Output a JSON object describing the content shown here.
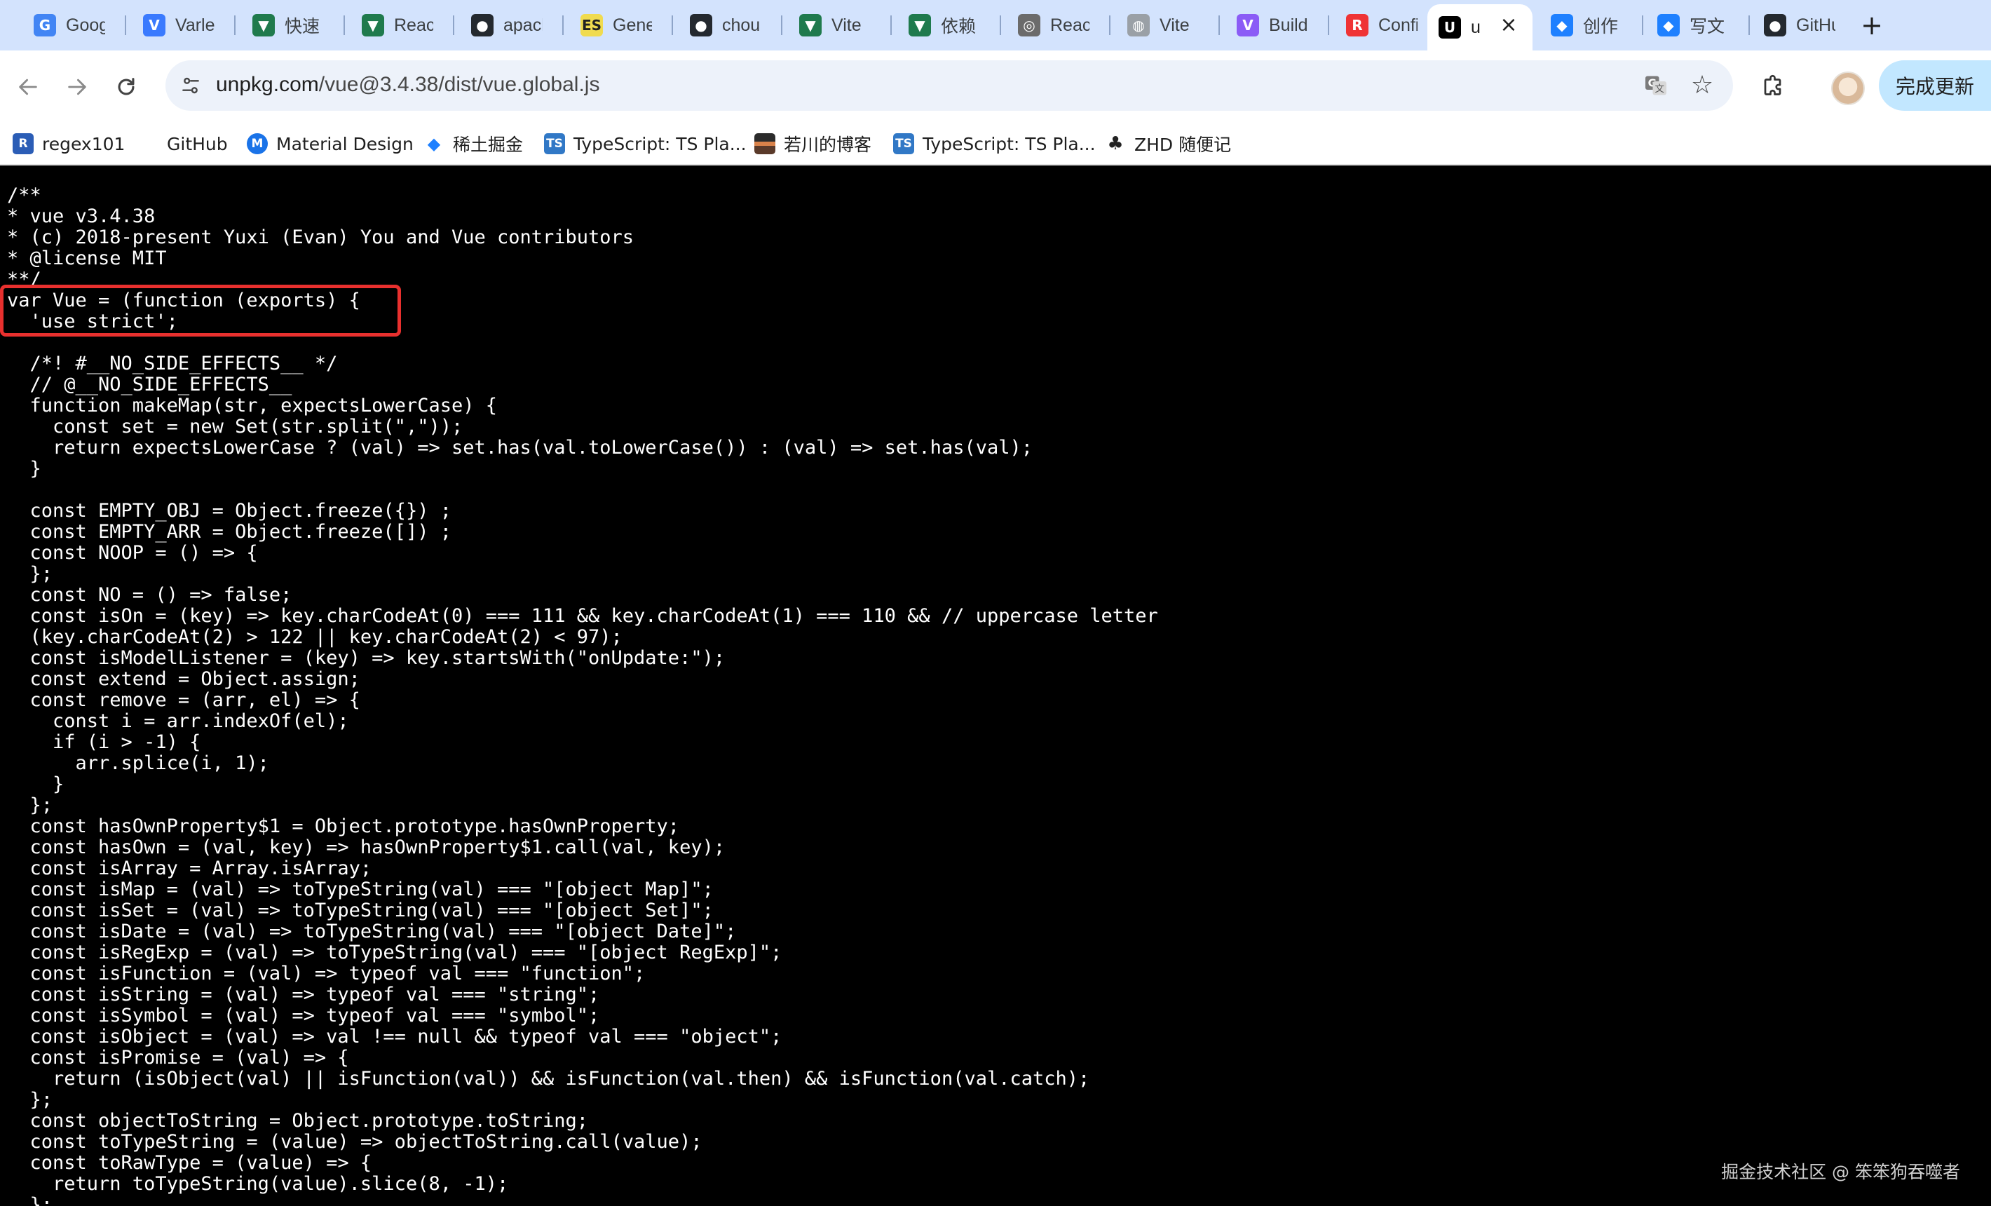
{
  "tabs": [
    {
      "label": "Goog",
      "icon": "google-translate-icon",
      "color": "#4285f4",
      "glyph": "G"
    },
    {
      "label": "Varle",
      "icon": "varlet-icon",
      "color": "#3a7afe",
      "glyph": "V"
    },
    {
      "label": "快速",
      "icon": "vue-icon",
      "color": "#1f7a4d",
      "glyph": "▼"
    },
    {
      "label": "Reac",
      "icon": "vue-icon",
      "color": "#1f7a4d",
      "glyph": "▼"
    },
    {
      "label": "apacl",
      "icon": "github-icon",
      "color": "#24292f",
      "glyph": "●"
    },
    {
      "label": "Gene",
      "icon": "es-icon",
      "color": "#f0db4f",
      "glyph": "ES"
    },
    {
      "label": "chou",
      "icon": "github-icon",
      "color": "#24292f",
      "glyph": "●"
    },
    {
      "label": "Vite",
      "icon": "vue-icon",
      "color": "#1f7a4d",
      "glyph": "▼"
    },
    {
      "label": "依赖",
      "icon": "vue-icon",
      "color": "#1f7a4d",
      "glyph": "▼"
    },
    {
      "label": "Reac",
      "icon": "react-router-icon",
      "color": "#6b6b6b",
      "glyph": "◎"
    },
    {
      "label": "Vite",
      "icon": "globe-icon",
      "color": "#9aa0a6",
      "glyph": "◍"
    },
    {
      "label": "Build",
      "icon": "vite-icon",
      "color": "#8b5cf6",
      "glyph": "V"
    },
    {
      "label": "Confi",
      "icon": "rollup-icon",
      "color": "#ef3335",
      "glyph": "R"
    },
    {
      "label": "u",
      "icon": "unpkg-icon",
      "color": "#000000",
      "glyph": "U"
    },
    {
      "label": "创作",
      "icon": "juejin-icon",
      "color": "#1e80ff",
      "glyph": "◆"
    },
    {
      "label": "写文",
      "icon": "juejin-icon",
      "color": "#1e80ff",
      "glyph": "◆"
    },
    {
      "label": "GitHu",
      "icon": "github-icon",
      "color": "#24292f",
      "glyph": "●"
    }
  ],
  "active_tab_index": 13,
  "url": {
    "host": "unpkg.com",
    "path": "/vue@3.4.38/dist/vue.global.js"
  },
  "update_button": {
    "label": "完成更新"
  },
  "bookmarks": [
    {
      "label": "regex101",
      "icon": "regex101-icon",
      "color": "#2b5db6",
      "glyph": "R"
    },
    {
      "label": "GitHub",
      "icon": "github-icon",
      "color": "#ffffff",
      "glyph": ""
    },
    {
      "label": "Material Design",
      "icon": "material-design-icon",
      "color": "#1a73e8",
      "glyph": "M"
    },
    {
      "label": "稀土掘金",
      "icon": "juejin-icon",
      "color": "#1e80ff",
      "glyph": "◆"
    },
    {
      "label": "TypeScript: TS Pla...",
      "icon": "typescript-icon",
      "color": "#3178c6",
      "glyph": "TS"
    },
    {
      "label": "若川的博客",
      "icon": "blog-thumbnail-icon",
      "color": "#8a5a3a",
      "glyph": ""
    },
    {
      "label": "TypeScript: TS Pla...",
      "icon": "typescript-icon",
      "color": "#3178c6",
      "glyph": "TS"
    },
    {
      "label": "ZHD 随便记",
      "icon": "zhd-icon",
      "color": "#222222",
      "glyph": "♣"
    }
  ],
  "code_lines": [
    "/**",
    "* vue v3.4.38",
    "* (c) 2018-present Yuxi (Evan) You and Vue contributors",
    "* @license MIT",
    "**/",
    "var Vue = (function (exports) {",
    "  'use strict';",
    "",
    "  /*! #__NO_SIDE_EFFECTS__ */",
    "  // @__NO_SIDE_EFFECTS__",
    "  function makeMap(str, expectsLowerCase) {",
    "    const set = new Set(str.split(\",\"));",
    "    return expectsLowerCase ? (val) => set.has(val.toLowerCase()) : (val) => set.has(val);",
    "  }",
    "",
    "  const EMPTY_OBJ = Object.freeze({}) ;",
    "  const EMPTY_ARR = Object.freeze([]) ;",
    "  const NOOP = () => {",
    "  };",
    "  const NO = () => false;",
    "  const isOn = (key) => key.charCodeAt(0) === 111 && key.charCodeAt(1) === 110 && // uppercase letter",
    "  (key.charCodeAt(2) > 122 || key.charCodeAt(2) < 97);",
    "  const isModelListener = (key) => key.startsWith(\"onUpdate:\");",
    "  const extend = Object.assign;",
    "  const remove = (arr, el) => {",
    "    const i = arr.indexOf(el);",
    "    if (i > -1) {",
    "      arr.splice(i, 1);",
    "    }",
    "  };",
    "  const hasOwnProperty$1 = Object.prototype.hasOwnProperty;",
    "  const hasOwn = (val, key) => hasOwnProperty$1.call(val, key);",
    "  const isArray = Array.isArray;",
    "  const isMap = (val) => toTypeString(val) === \"[object Map]\";",
    "  const isSet = (val) => toTypeString(val) === \"[object Set]\";",
    "  const isDate = (val) => toTypeString(val) === \"[object Date]\";",
    "  const isRegExp = (val) => toTypeString(val) === \"[object RegExp]\";",
    "  const isFunction = (val) => typeof val === \"function\";",
    "  const isString = (val) => typeof val === \"string\";",
    "  const isSymbol = (val) => typeof val === \"symbol\";",
    "  const isObject = (val) => val !== null && typeof val === \"object\";",
    "  const isPromise = (val) => {",
    "    return (isObject(val) || isFunction(val)) && isFunction(val.then) && isFunction(val.catch);",
    "  };",
    "  const objectToString = Object.prototype.toString;",
    "  const toTypeString = (value) => objectToString.call(value);",
    "  const toRawType = (value) => {",
    "    return toTypeString(value).slice(8, -1);",
    "  };"
  ],
  "highlighted_lines": [
    5,
    6
  ],
  "watermark": "掘金技术社区 @ 笨笨狗吞噬者",
  "colors": {
    "tab_strip": "#d3e3fd",
    "omnibox": "#edf2fa",
    "update_button": "#c2e7ff",
    "highlight_border": "#e8302e",
    "code_background": "#000000",
    "code_text": "#ffffff"
  }
}
